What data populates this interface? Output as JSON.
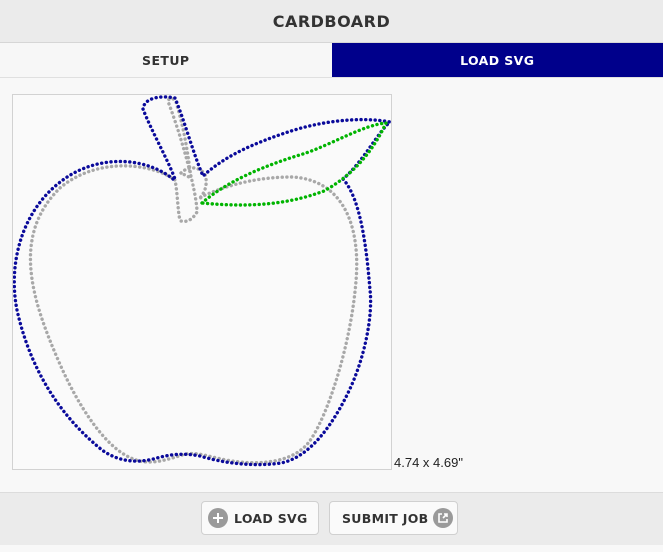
{
  "app": {
    "title": "CARDBOARD"
  },
  "tabs": [
    {
      "label": "SETUP",
      "active": false
    },
    {
      "label": "LOAD SVG",
      "active": true
    }
  ],
  "preview": {
    "dimensions_label": "4.74 x 4.69\"",
    "paths": [
      {
        "name": "apple-body-outer-outline",
        "color": "#0a0a9a"
      },
      {
        "name": "apple-body-inner-outline",
        "color": "#a8a8a8"
      },
      {
        "name": "apple-leaf-outline",
        "color": "#00b400"
      }
    ]
  },
  "footer": {
    "load_svg_label": "LOAD SVG",
    "load_svg_icon": "plus-circle-icon",
    "submit_job_label": "SUBMIT JOB",
    "submit_job_icon": "share-external-icon"
  },
  "colors": {
    "accent": "#00008b",
    "header_bg": "#ebebeb",
    "outer_path": "#0a0a9a",
    "inner_path": "#a8a8a8",
    "leaf_path": "#00b400"
  }
}
